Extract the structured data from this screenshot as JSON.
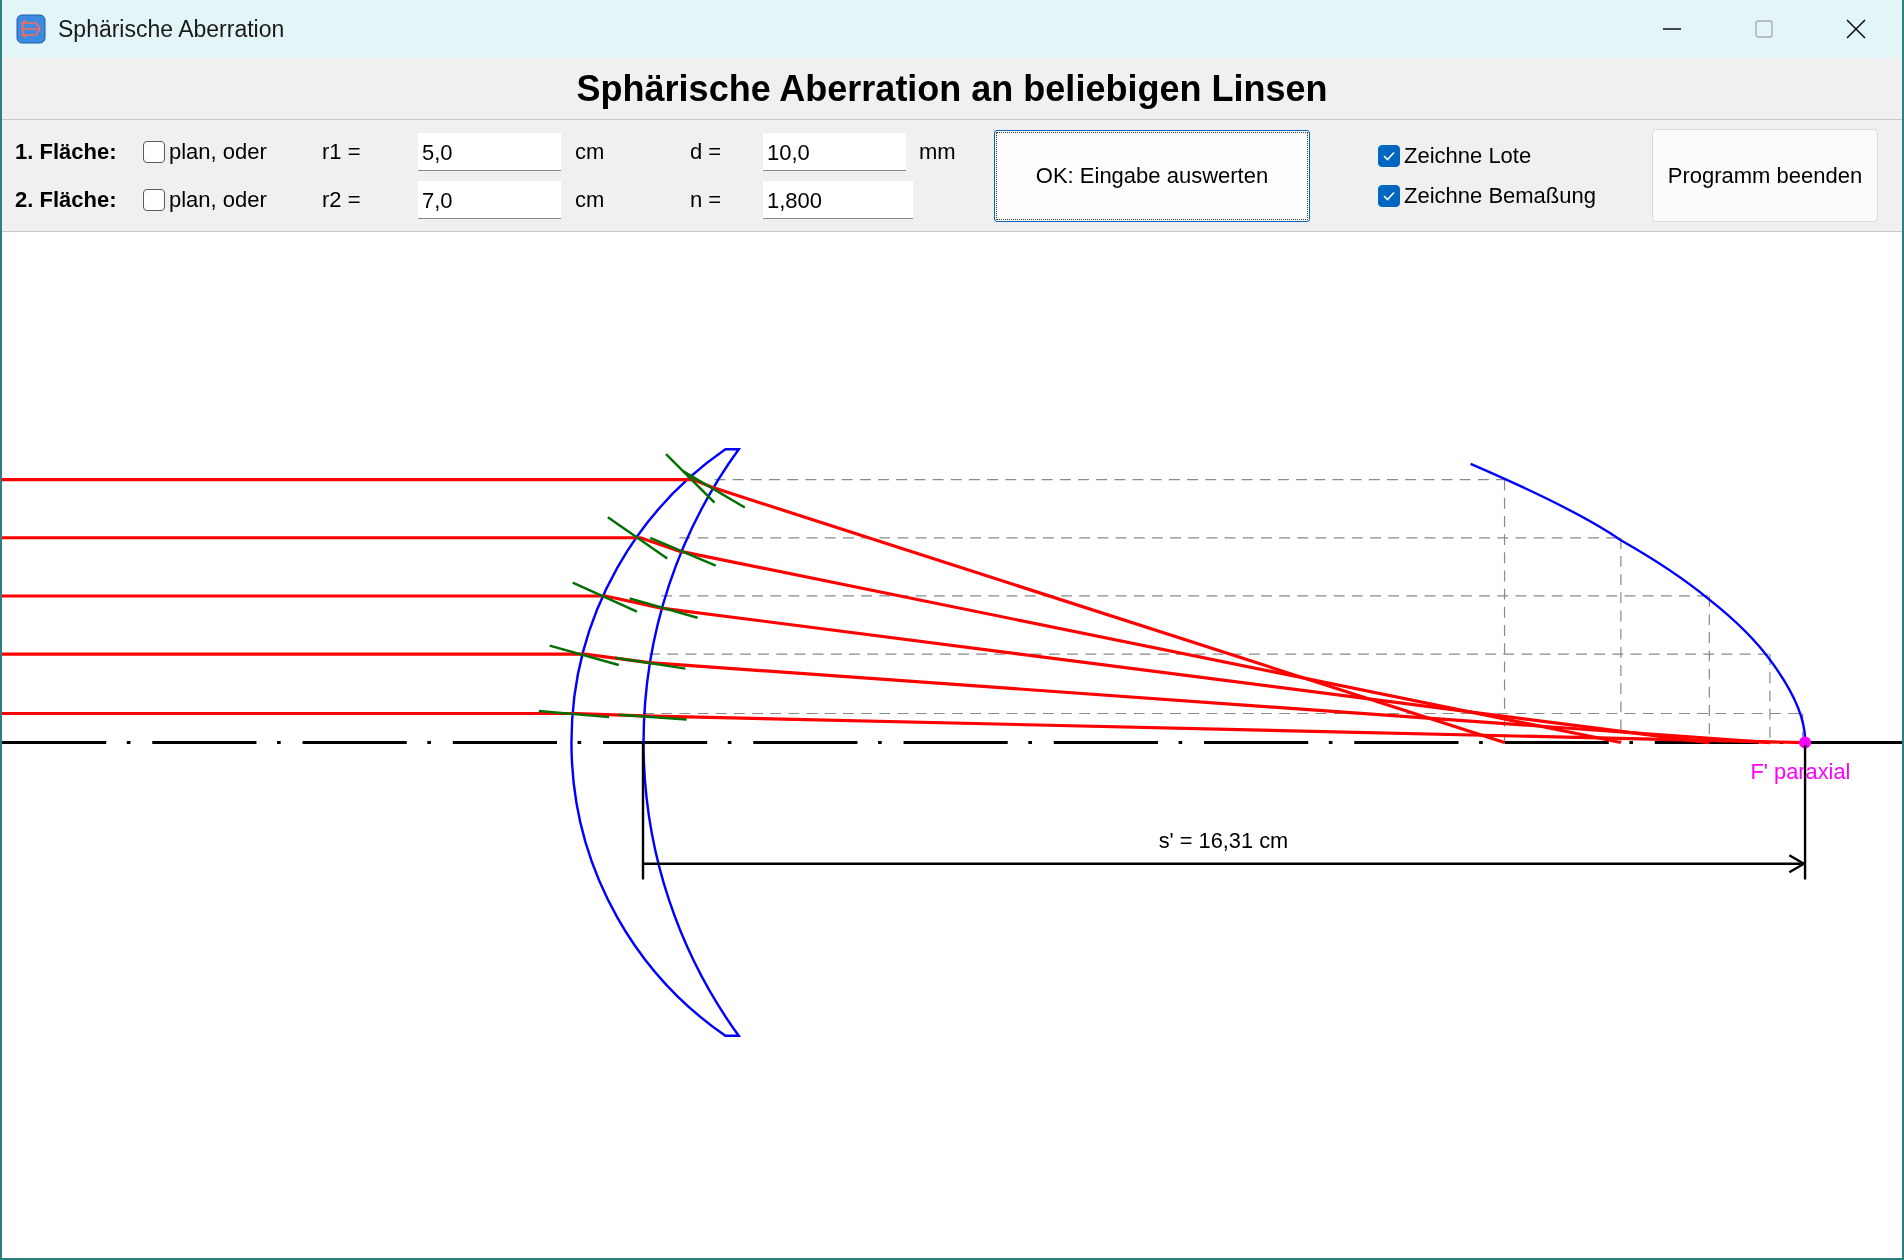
{
  "window": {
    "title": "Sphärische Aberration"
  },
  "heading": "Sphärische Aberration an beliebigen Linsen",
  "surfaces": [
    {
      "label": "1. Fläche:",
      "plan_label": "plan, oder",
      "plan_checked": false,
      "radius_label": "r1 =",
      "radius": "5,0",
      "radius_unit": "cm"
    },
    {
      "label": "2. Fläche:",
      "plan_label": "plan, oder",
      "plan_checked": false,
      "radius_label": "r2 =",
      "radius": "7,0",
      "radius_unit": "cm"
    }
  ],
  "thickness": {
    "label": "d =",
    "value": "10,0",
    "unit": "mm"
  },
  "index": {
    "label": "n =",
    "value": "1,800"
  },
  "evaluate_button": "OK: Eingabe auswerten",
  "options": [
    {
      "label": "Zeichne Lote",
      "checked": true
    },
    {
      "label": "Zeichne Bemaßung",
      "checked": true
    }
  ],
  "quit_button": "Programm beenden",
  "diagram": {
    "focus_label": "F' paraxial",
    "dimension_label": "s' = 16,31 cm"
  }
}
